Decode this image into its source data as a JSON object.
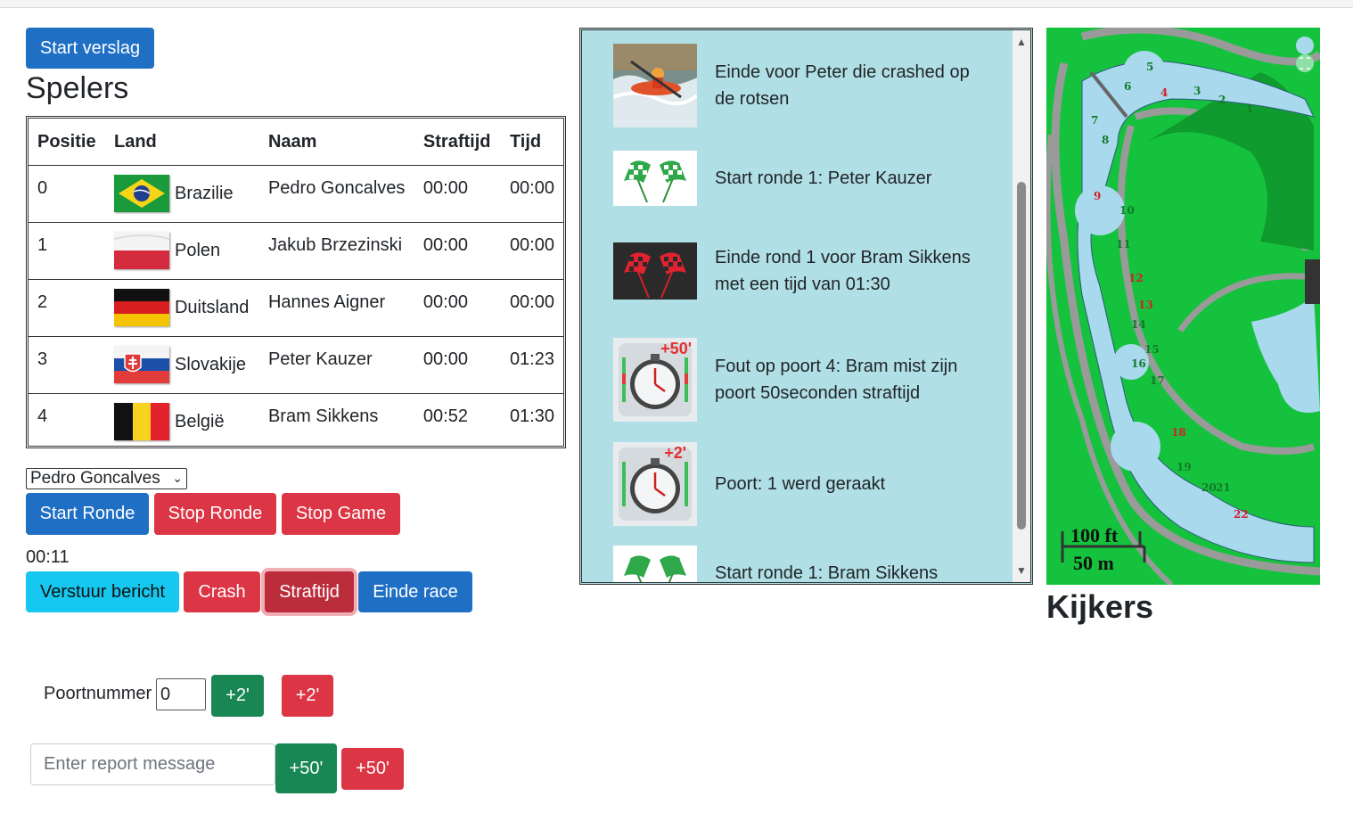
{
  "header": {
    "start_report": "Start verslag",
    "players_title": "Spelers"
  },
  "table": {
    "columns": [
      "Positie",
      "Land",
      "Naam",
      "Straftijd",
      "Tijd"
    ],
    "rows": [
      {
        "pos": "0",
        "country": "Brazilie",
        "flag": "flag-brazil-icon",
        "name": "Pedro Goncalves",
        "penalty": "00:00",
        "time": "00:00"
      },
      {
        "pos": "1",
        "country": "Polen",
        "flag": "flag-poland-icon",
        "name": "Jakub Brzezinski",
        "penalty": "00:00",
        "time": "00:00"
      },
      {
        "pos": "2",
        "country": "Duitsland",
        "flag": "flag-germany-icon",
        "name": "Hannes Aigner",
        "penalty": "00:00",
        "time": "00:00"
      },
      {
        "pos": "3",
        "country": "Slovakije",
        "flag": "flag-slovakia-icon",
        "name": "Peter Kauzer",
        "penalty": "00:00",
        "time": "01:23"
      },
      {
        "pos": "4",
        "country": "België",
        "flag": "flag-belgium-icon",
        "name": "Bram Sikkens",
        "penalty": "00:52",
        "time": "01:30"
      }
    ]
  },
  "controls": {
    "selected_player": "Pedro Goncalves",
    "start_round": "Start Ronde",
    "stop_round": "Stop Ronde",
    "stop_game": "Stop Game",
    "timer": "00:11",
    "send_message": "Verstuur bericht",
    "crash": "Crash",
    "penalty": "Straftijd",
    "end_race": "Einde race",
    "gate_label": "Poortnummer",
    "gate_value": "0",
    "plus2_green": "+2'",
    "plus2_red": "+2'",
    "report_placeholder": "Enter report message",
    "plus50_green": "+50'",
    "plus50_red": "+50'"
  },
  "feed": [
    {
      "icon": "kayak-crash-photo-icon",
      "text": "Einde voor Peter die crashed op de rotsen"
    },
    {
      "icon": "green-checkered-flags-icon",
      "text": "Start ronde 1: Peter Kauzer"
    },
    {
      "icon": "red-checkered-flags-icon",
      "text": "Einde rond 1 voor Bram Sikkens met een tijd van 01:30"
    },
    {
      "icon": "stopwatch-plus50-icon",
      "badge": "+50'",
      "text": "Fout op poort 4: Bram mist zijn poort 50seconden straftijd"
    },
    {
      "icon": "stopwatch-plus2-icon",
      "badge": "+2'",
      "text": "Poort: 1 werd geraakt"
    },
    {
      "icon": "green-checkered-flags-icon",
      "text": "Start ronde 1: Bram Sikkens"
    }
  ],
  "map": {
    "gates": [
      "1",
      "2",
      "3",
      "4",
      "5",
      "6",
      "7",
      "8",
      "9",
      "10",
      "11",
      "12",
      "13",
      "14",
      "15",
      "16",
      "17",
      "18",
      "19",
      "20",
      "21",
      "22"
    ],
    "scale_ft": "100 ft",
    "scale_m": "50 m"
  },
  "viewers_title": "Kijkers",
  "colors": {
    "primary": "#1f6fc5",
    "danger": "#dc3545",
    "success": "#198754",
    "info": "#16c7ef",
    "feed_bg": "#b0dfe5",
    "map_green": "#15c23d",
    "water": "#a9d9ec"
  }
}
